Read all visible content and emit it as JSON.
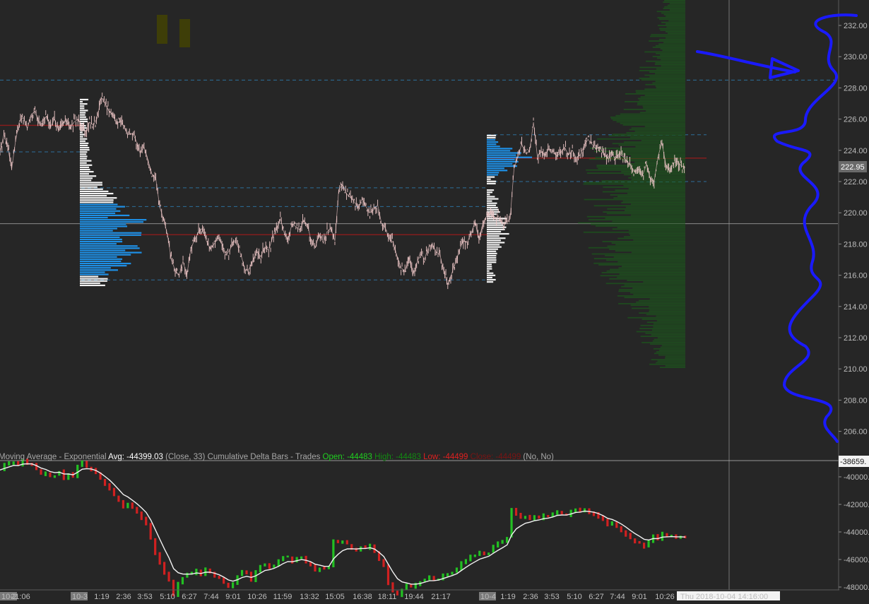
{
  "chart_data": [
    {
      "type": "line",
      "panel": "price",
      "y_axis_labels": [
        "232.00",
        "230.00",
        "228.00",
        "226.00",
        "224.00",
        "222.00",
        "220.00",
        "218.00",
        "216.00",
        "214.00",
        "212.00",
        "210.00",
        "208.00",
        "206.00"
      ],
      "ylim": [
        205,
        233
      ],
      "last_price_label": "222.95",
      "reference_lines": {
        "dashed_blue": [
          228.5,
          225.0,
          223.9,
          222.0,
          221.6,
          220.4,
          215.7
        ],
        "solid_red": [
          225.6,
          218.6,
          223.5
        ],
        "crosshair_gray": 219.3
      },
      "series": [
        {
          "values": [
            223.9,
            225.0,
            224.2,
            222.8,
            224.6,
            225.9,
            226.1,
            225.4,
            226.3,
            226.5,
            225.8,
            225.9,
            226.2,
            225.5,
            226.0,
            225.3,
            225.7,
            225.9,
            225.4,
            225.8,
            226.0,
            225.6,
            225.2,
            225.8,
            225.6,
            226.1,
            227.4,
            227.0,
            226.5,
            226.3,
            225.7,
            225.9,
            225.4,
            225.0,
            225.1,
            224.6,
            223.8,
            224.2,
            223.4,
            222.5,
            222.2,
            220.4,
            219.6,
            218.6,
            217.0,
            216.3,
            216.0,
            216.9,
            216.0,
            217.7,
            218.3,
            218.8,
            219.0,
            218.2,
            217.7,
            218.0,
            218.4,
            218.0,
            217.3,
            217.6,
            218.2,
            217.9,
            217.2,
            216.3,
            216.4,
            217.0,
            217.5,
            217.2,
            217.8,
            217.6,
            218.4,
            219.0,
            219.6,
            218.7,
            218.3,
            219.3,
            219.1,
            218.9,
            219.5,
            219.2,
            218.1,
            217.8,
            218.6,
            218.1,
            218.8,
            219.0,
            218.2,
            221.5,
            221.8,
            221.2,
            221.0,
            220.7,
            220.3,
            220.9,
            220.4,
            220.0,
            220.2,
            220.5,
            219.3,
            219.0,
            218.3,
            218.1,
            217.2,
            216.5,
            216.2,
            217.2,
            216.0,
            216.7,
            217.5,
            217.0,
            217.8,
            218.0,
            217.5,
            217.3,
            216.2,
            215.4,
            216.1,
            216.8,
            217.6,
            218.2,
            218.1,
            218.7,
            219.4,
            218.3,
            219.3,
            219.8,
            220.1,
            219.6,
            219.8,
            219.3,
            219.4,
            219.6,
            222.8,
            223.6,
            224.4,
            223.8,
            223.9,
            225.8,
            223.6,
            223.9,
            223.7,
            224.1,
            224.0,
            223.6,
            223.9,
            224.2,
            223.7,
            224.0,
            223.5,
            223.7,
            224.3,
            224.7,
            224.4,
            224.1,
            224.2,
            223.8,
            223.5,
            223.9,
            223.4,
            223.8,
            223.6,
            223.3,
            223.0,
            222.6,
            222.8,
            222.4,
            223.1,
            222.2,
            222.0,
            223.6,
            224.5,
            223.1,
            222.6,
            223.2,
            223.3,
            223.0,
            222.9
          ]
        }
      ]
    },
    {
      "type": "bar",
      "panel": "cumulative_delta",
      "y_axis_labels": [
        "-40000.",
        "-42000.",
        "-44000.",
        "-46000.",
        "-48000."
      ],
      "ylim": [
        -49400,
        -38400
      ],
      "last_value_label": "-38659.",
      "series": [
        {
          "name": "Cumulative Delta Bars - Trades",
          "values": [
            -39500,
            -39100,
            -39000,
            -38900,
            -39200,
            -38800,
            -39000,
            -39100,
            -39500,
            -39800,
            -39700,
            -40000,
            -39900,
            -39600,
            -40100,
            -39800,
            -40000,
            -39200,
            -38900,
            -39300,
            -39500,
            -39800,
            -40200,
            -40600,
            -40900,
            -41400,
            -41800,
            -42200,
            -41900,
            -42300,
            -42600,
            -43000,
            -43400,
            -44500,
            -45600,
            -46300,
            -47000,
            -47500,
            -48600,
            -47700,
            -47300,
            -47100,
            -47000,
            -46800,
            -47100,
            -46700,
            -46900,
            -47200,
            -47400,
            -47700,
            -48000,
            -47800,
            -47200,
            -46900,
            -47000,
            -47500,
            -46900,
            -46500,
            -46300,
            -46600,
            -46400,
            -46100,
            -45800,
            -45800,
            -46200,
            -45900,
            -45800,
            -46200,
            -46400,
            -46800,
            -46600,
            -46700,
            -46500,
            -44600,
            -44800,
            -44700,
            -44900,
            -45200,
            -45300,
            -45100,
            -45200,
            -45000,
            -45500,
            -46100,
            -46500,
            -47800,
            -48300,
            -48600,
            -48200,
            -47900,
            -48000,
            -47800,
            -47600,
            -47400,
            -47300,
            -47500,
            -47400,
            -47100,
            -47000,
            -46900,
            -46700,
            -46200,
            -46000,
            -45800,
            -45700,
            -45500,
            -45600,
            -45500,
            -45000,
            -44800,
            -44700,
            -44400,
            -42400,
            -42700,
            -43000,
            -42900,
            -43100,
            -42900,
            -43000,
            -42800,
            -42900,
            -42700,
            -42500,
            -42700,
            -42800,
            -42500,
            -42300,
            -42500,
            -42300,
            -42600,
            -42700,
            -42900,
            -43200,
            -43500,
            -43300,
            -43600,
            -43900,
            -44200,
            -44500,
            -44700,
            -44800,
            -45100,
            -44700,
            -44200,
            -44500,
            -44100,
            -44300,
            -44300,
            -44400,
            -44350,
            -44400
          ]
        },
        {
          "name": "Moving Average - Exponential",
          "smoothing_of": "Cumulative Delta Bars - Trades"
        }
      ]
    }
  ],
  "time_axis": {
    "session_markers": [
      "10-2",
      "10-3",
      "10-4"
    ],
    "ticks": [
      "21:06",
      "1:19",
      "2:36",
      "3:53",
      "5:10",
      "6:27",
      "7:44",
      "9:01",
      "10:26",
      "11:59",
      "13:32",
      "15:05",
      "16:38",
      "18:11",
      "19:44",
      "21:17",
      "1:19",
      "2:36",
      "3:53",
      "5:10",
      "6:27",
      "7:44",
      "9:01",
      "10:26"
    ],
    "cursor_label": "Thu 2018-10-04  14:16:00"
  },
  "indicator_bar": {
    "segments": [
      {
        "text": "Moving Average - Exponential",
        "color": "#a8a8a8"
      },
      {
        "text": "Avg: -44399.03",
        "color": "#ffffff"
      },
      {
        "text": "(Close, 33)",
        "color": "#a8a8a8"
      },
      {
        "text": "Cumulative Delta Bars - Trades",
        "color": "#a8a8a8"
      },
      {
        "text": "Open: -44483",
        "color": "#20d020"
      },
      {
        "text": "High: -44483",
        "color": "#128a12"
      },
      {
        "text": "Low: -44499",
        "color": "#e02020"
      },
      {
        "text": "Close: -44499",
        "color": "#7a1414"
      },
      {
        "text": "(No, No)",
        "color": "#a8a8a8"
      }
    ]
  },
  "colors": {
    "background": "#262626",
    "candle": "#f0c8c8",
    "profile_blue": "#1e90e6",
    "profile_white": "#f2f2f2",
    "volume_green": "#1e4a1e",
    "dashed_level": "#2e6f9a",
    "red_level": "#8c1c1c",
    "annotation": "#1a1aff",
    "delta_up": "#22c022",
    "delta_down": "#d02020",
    "ema": "#f2f2f2",
    "placeholder_bars": "#3e3e08"
  }
}
